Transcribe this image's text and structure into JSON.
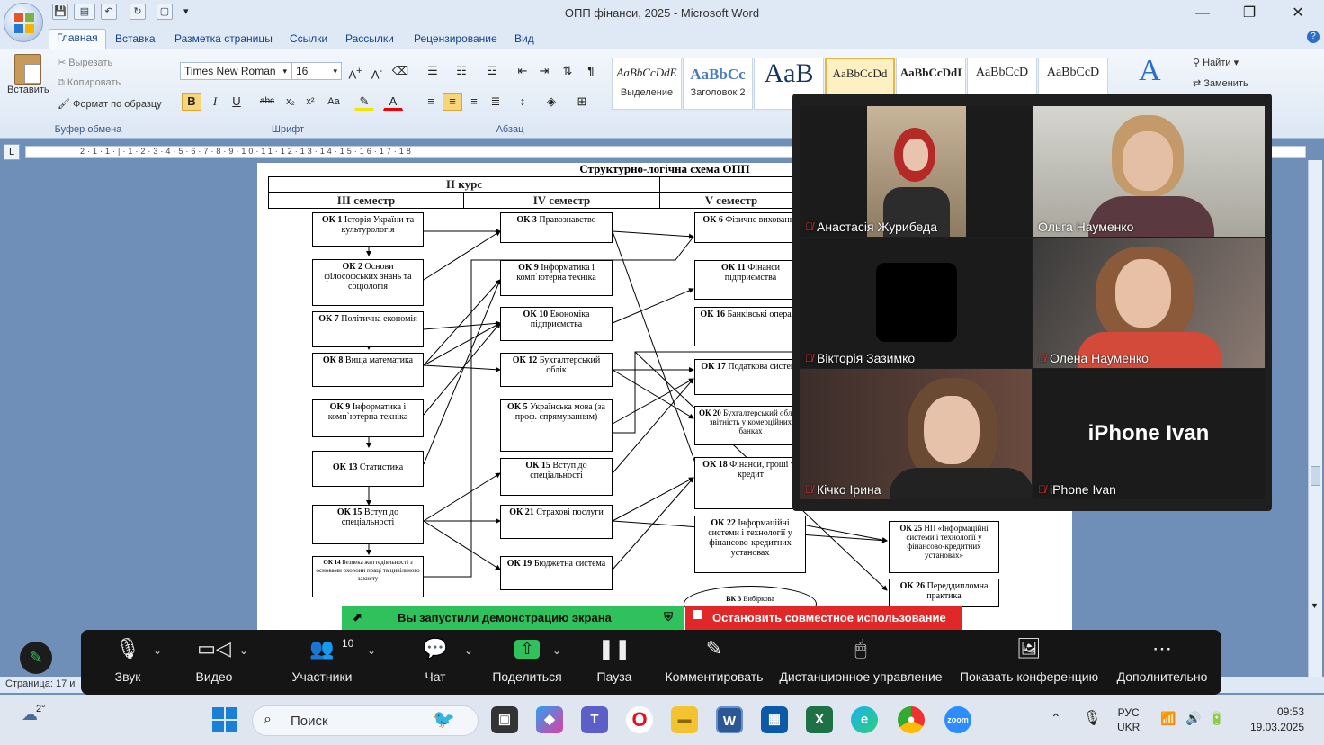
{
  "window": {
    "title": "ОПП фінанси, 2025  -  Microsoft Word"
  },
  "tabs": [
    "Главная",
    "Вставка",
    "Разметка страницы",
    "Ссылки",
    "Рассылки",
    "Рецензирование",
    "Вид"
  ],
  "clipboard": {
    "paste": "Вставить",
    "cut": "Вырезать",
    "copy": "Копировать",
    "format_painter": "Формат по образцу",
    "group": "Буфер обмена"
  },
  "font": {
    "name": "Times New Roman",
    "size": "16",
    "group": "Шрифт"
  },
  "paragraph": {
    "group": "Абзац"
  },
  "styles": [
    {
      "sample": "AaBbCcDdE",
      "name": "Выделение"
    },
    {
      "sample": "AaBbCc",
      "name": "Заголовок 2"
    },
    {
      "sample": "AaB",
      "name": "Назва"
    },
    {
      "sample": "AaBbCcDd",
      "name": ""
    },
    {
      "sample": "AaBbCcDdI",
      "name": ""
    },
    {
      "sample": "AaBbCcD",
      "name": ""
    },
    {
      "sample": "AaBbCcD",
      "name": ""
    }
  ],
  "editing": {
    "find": "Найти",
    "replace": "Заменить"
  },
  "ruler": "2·1·1·|·1·2·3·4·5·6·7·8·9·10·11·12·13·14·15·16·17·18",
  "document": {
    "title": "Структурно-логічна схема ОПП",
    "course": "II курс",
    "sem3": "III семестр",
    "sem4": "IV семестр",
    "sem5": "V семестр",
    "col1": [
      {
        "code": "ОК 1",
        "text": "Історія України та культурологія"
      },
      {
        "code": "ОК 2",
        "text": "Основи філософських знань та соціологія"
      },
      {
        "code": "ОК 7",
        "text": "Політична економія"
      },
      {
        "code": "ОК 8",
        "text": "Вища математика"
      },
      {
        "code": "ОК 9",
        "text": "Інформатика і комп`ютерна техніка"
      },
      {
        "code": "ОК 13",
        "text": "Статистика"
      },
      {
        "code": "ОК 15",
        "text": "Вступ до спеціальності"
      },
      {
        "code": "ОК 14",
        "text": "Безпека життєдіяльності з основами охорони праці та цивільного захисту"
      }
    ],
    "col2": [
      {
        "code": "ОК 3",
        "text": "Правознавство"
      },
      {
        "code": "ОК 9",
        "text": "Інформатика і комп`ютерна техніка"
      },
      {
        "code": "ОК 10",
        "text": "Економіка підприємства"
      },
      {
        "code": "ОК 12",
        "text": "Бухгалтерський облік"
      },
      {
        "code": "ОК 5",
        "text": "Українська мова (за проф. спрямуванням)"
      },
      {
        "code": "ОК 15",
        "text": "Вступ до спеціальності"
      },
      {
        "code": "ОК 21",
        "text": "Страхові послуги"
      },
      {
        "code": "ОК 19",
        "text": "Бюджетна система"
      }
    ],
    "col3": [
      {
        "code": "ОК 6",
        "text": "Фізичне виховання"
      },
      {
        "code": "ОК 11",
        "text": "Фінанси підприємства"
      },
      {
        "code": "ОК 16",
        "text": "Банківські операції"
      },
      {
        "code": "ОК 17",
        "text": "Податкова система"
      },
      {
        "code": "ОК 20",
        "text": "Бухгалтерський облік і звітність у комерційних банках"
      },
      {
        "code": "ОК 18",
        "text": "Фінанси, гроші та кредит"
      },
      {
        "code": "ОК 22",
        "text": "Інформаційні системи і технології у фінансово-кредитних установах"
      },
      {
        "code": "ВК 3",
        "text": "Вибіркова"
      }
    ],
    "col4": [
      {
        "code": "ОК 25",
        "text": "НП «Інформаційні системи і технології у фінансово-кредитних установах»"
      },
      {
        "code": "ОК 26",
        "text": "Переддипломна практика"
      }
    ]
  },
  "participants": [
    {
      "name": "Анастасія  Журибеда",
      "muted": true
    },
    {
      "name": "Ольга Науменко",
      "muted": false
    },
    {
      "name": "Вікторія Зазимко",
      "muted": true
    },
    {
      "name": "Олена Науменко",
      "muted": true
    },
    {
      "name": "Кічко Ірина",
      "muted": true
    },
    {
      "name": "iPhone Ivan",
      "muted": true,
      "big_label": "iPhone Ivan"
    }
  ],
  "share": {
    "banner": "Вы запустили демонстрацию экрана",
    "stop": "Остановить совместное использование"
  },
  "zoom_toolbar": {
    "audio": "Звук",
    "video": "Видео",
    "participants": "Участники",
    "participants_count": "10",
    "chat": "Чат",
    "share": "Поделиться",
    "pause": "Пауза",
    "annotate": "Комментировать",
    "remote": "Дистанционное управление",
    "show_conf": "Показать конференцию",
    "more": "Дополнительно"
  },
  "status": {
    "page": "Страница: 17 и"
  },
  "taskbar": {
    "weather": "2°",
    "search": "Поиск",
    "lang1": "РУС",
    "lang2": "UKR",
    "time": "09:53",
    "date": "19.03.2025"
  }
}
